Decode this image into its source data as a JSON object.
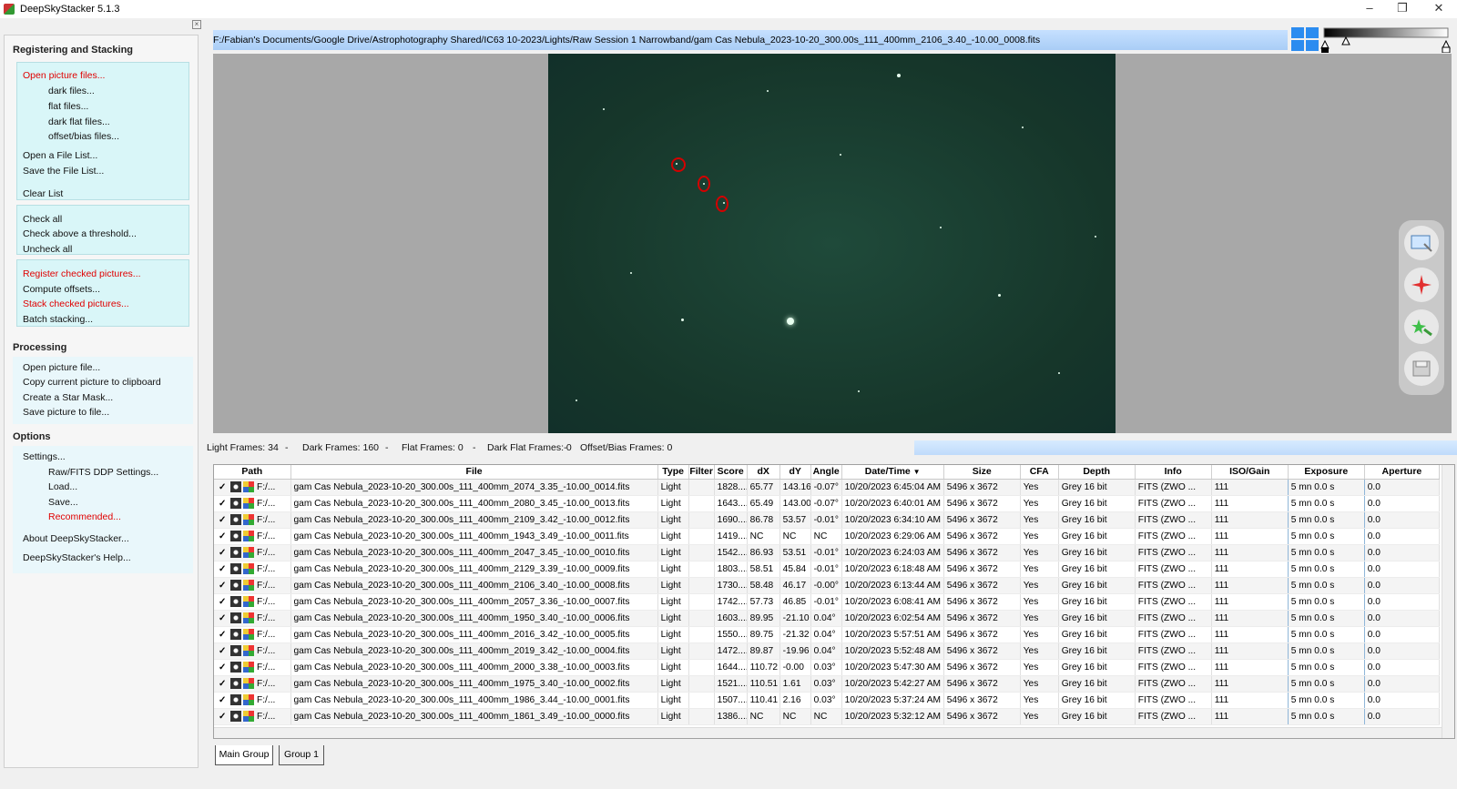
{
  "window": {
    "title": "DeepSkyStacker 5.1.3",
    "controls": [
      "–",
      "❐",
      "✕"
    ]
  },
  "sidebar": {
    "section_registering": "Registering and Stacking",
    "open_picture_files": "Open picture files...",
    "dark_files": "dark files...",
    "flat_files": "flat files...",
    "dark_flat_files": "dark flat files...",
    "offset_bias_files": "offset/bias files...",
    "open_file_list": "Open a File List...",
    "save_file_list": "Save the File List...",
    "clear_list": "Clear List",
    "check_all": "Check all",
    "check_above": "Check above a threshold...",
    "uncheck_all": "Uncheck all",
    "register_checked": "Register checked pictures...",
    "compute_offsets": "Compute offsets...",
    "stack_checked": "Stack checked pictures...",
    "batch_stacking": "Batch stacking...",
    "section_processing": "Processing",
    "open_picture_file": "Open picture file...",
    "copy_clipboard": "Copy current picture to clipboard",
    "create_star_mask": "Create a Star Mask...",
    "save_picture": "Save picture to file...",
    "section_options": "Options",
    "settings": "Settings...",
    "raw_fits": "Raw/FITS DDP Settings...",
    "load": "Load...",
    "save": "Save...",
    "recommended": "Recommended...",
    "about": "About DeepSkyStacker...",
    "help": "DeepSkyStacker's Help..."
  },
  "viewer": {
    "path": "F:/Fabian's Documents/Google Drive/Astrophotography Shared/IC63 10-2023/Lights/Raw Session 1 Narrowband/gam Cas Nebula_2023-10-20_300.00s_111_400mm_2106_3.40_-10.00_0008.fits"
  },
  "counts": {
    "light": "Light Frames: 34",
    "dark": "Dark Frames: 160",
    "flat": "Flat Frames: 0",
    "dark_flat": "Dark Flat Frames: 0",
    "offset": "Offset/Bias Frames: 0",
    "sep": "-"
  },
  "table": {
    "columns": [
      "Path",
      "File",
      "Type",
      "Filter",
      "Score",
      "dX",
      "dY",
      "Angle",
      "Date/Time",
      "Size",
      "CFA",
      "Depth",
      "Info",
      "ISO/Gain",
      "Exposure",
      "Aperture"
    ],
    "rows": [
      [
        "F:/...",
        "gam Cas Nebula_2023-10-20_300.00s_111_400mm_2074_3.35_-10.00_0014.fits",
        "Light",
        "",
        "1828....",
        "65.77",
        "143.16",
        "-0.07°",
        "10/20/2023 6:45:04 AM",
        "5496 x 3672",
        "Yes",
        "Grey 16 bit",
        "FITS (ZWO ...",
        "111",
        "5 mn 0.0 s",
        "0.0"
      ],
      [
        "F:/...",
        "gam Cas Nebula_2023-10-20_300.00s_111_400mm_2080_3.45_-10.00_0013.fits",
        "Light",
        "",
        "1643....",
        "65.49",
        "143.00",
        "-0.07°",
        "10/20/2023 6:40:01 AM",
        "5496 x 3672",
        "Yes",
        "Grey 16 bit",
        "FITS (ZWO ...",
        "111",
        "5 mn 0.0 s",
        "0.0"
      ],
      [
        "F:/...",
        "gam Cas Nebula_2023-10-20_300.00s_111_400mm_2109_3.42_-10.00_0012.fits",
        "Light",
        "",
        "1690....",
        "86.78",
        "53.57",
        "-0.01°",
        "10/20/2023 6:34:10 AM",
        "5496 x 3672",
        "Yes",
        "Grey 16 bit",
        "FITS (ZWO ...",
        "111",
        "5 mn 0.0 s",
        "0.0"
      ],
      [
        "F:/...",
        "gam Cas Nebula_2023-10-20_300.00s_111_400mm_1943_3.49_-10.00_0011.fits",
        "Light",
        "",
        "1419....",
        "NC",
        "NC",
        "NC",
        "10/20/2023 6:29:06 AM",
        "5496 x 3672",
        "Yes",
        "Grey 16 bit",
        "FITS (ZWO ...",
        "111",
        "5 mn 0.0 s",
        "0.0"
      ],
      [
        "F:/...",
        "gam Cas Nebula_2023-10-20_300.00s_111_400mm_2047_3.45_-10.00_0010.fits",
        "Light",
        "",
        "1542....",
        "86.93",
        "53.51",
        "-0.01°",
        "10/20/2023 6:24:03 AM",
        "5496 x 3672",
        "Yes",
        "Grey 16 bit",
        "FITS (ZWO ...",
        "111",
        "5 mn 0.0 s",
        "0.0"
      ],
      [
        "F:/...",
        "gam Cas Nebula_2023-10-20_300.00s_111_400mm_2129_3.39_-10.00_0009.fits",
        "Light",
        "",
        "1803....",
        "58.51",
        "45.84",
        "-0.01°",
        "10/20/2023 6:18:48 AM",
        "5496 x 3672",
        "Yes",
        "Grey 16 bit",
        "FITS (ZWO ...",
        "111",
        "5 mn 0.0 s",
        "0.0"
      ],
      [
        "F:/...",
        "gam Cas Nebula_2023-10-20_300.00s_111_400mm_2106_3.40_-10.00_0008.fits",
        "Light",
        "",
        "1730....",
        "58.48",
        "46.17",
        "-0.00°",
        "10/20/2023 6:13:44 AM",
        "5496 x 3672",
        "Yes",
        "Grey 16 bit",
        "FITS (ZWO ...",
        "111",
        "5 mn 0.0 s",
        "0.0"
      ],
      [
        "F:/...",
        "gam Cas Nebula_2023-10-20_300.00s_111_400mm_2057_3.36_-10.00_0007.fits",
        "Light",
        "",
        "1742....",
        "57.73",
        "46.85",
        "-0.01°",
        "10/20/2023 6:08:41 AM",
        "5496 x 3672",
        "Yes",
        "Grey 16 bit",
        "FITS (ZWO ...",
        "111",
        "5 mn 0.0 s",
        "0.0"
      ],
      [
        "F:/...",
        "gam Cas Nebula_2023-10-20_300.00s_111_400mm_1950_3.40_-10.00_0006.fits",
        "Light",
        "",
        "1603....",
        "89.95",
        "-21.10",
        "0.04°",
        "10/20/2023 6:02:54 AM",
        "5496 x 3672",
        "Yes",
        "Grey 16 bit",
        "FITS (ZWO ...",
        "111",
        "5 mn 0.0 s",
        "0.0"
      ],
      [
        "F:/...",
        "gam Cas Nebula_2023-10-20_300.00s_111_400mm_2016_3.42_-10.00_0005.fits",
        "Light",
        "",
        "1550....",
        "89.75",
        "-21.32",
        "0.04°",
        "10/20/2023 5:57:51 AM",
        "5496 x 3672",
        "Yes",
        "Grey 16 bit",
        "FITS (ZWO ...",
        "111",
        "5 mn 0.0 s",
        "0.0"
      ],
      [
        "F:/...",
        "gam Cas Nebula_2023-10-20_300.00s_111_400mm_2019_3.42_-10.00_0004.fits",
        "Light",
        "",
        "1472....",
        "89.87",
        "-19.96",
        "0.04°",
        "10/20/2023 5:52:48 AM",
        "5496 x 3672",
        "Yes",
        "Grey 16 bit",
        "FITS (ZWO ...",
        "111",
        "5 mn 0.0 s",
        "0.0"
      ],
      [
        "F:/...",
        "gam Cas Nebula_2023-10-20_300.00s_111_400mm_2000_3.38_-10.00_0003.fits",
        "Light",
        "",
        "1644....",
        "110.72",
        "-0.00",
        "0.03°",
        "10/20/2023 5:47:30 AM",
        "5496 x 3672",
        "Yes",
        "Grey 16 bit",
        "FITS (ZWO ...",
        "111",
        "5 mn 0.0 s",
        "0.0"
      ],
      [
        "F:/...",
        "gam Cas Nebula_2023-10-20_300.00s_111_400mm_1975_3.40_-10.00_0002.fits",
        "Light",
        "",
        "1521....",
        "110.51",
        "1.61",
        "0.03°",
        "10/20/2023 5:42:27 AM",
        "5496 x 3672",
        "Yes",
        "Grey 16 bit",
        "FITS (ZWO ...",
        "111",
        "5 mn 0.0 s",
        "0.0"
      ],
      [
        "F:/...",
        "gam Cas Nebula_2023-10-20_300.00s_111_400mm_1986_3.44_-10.00_0001.fits",
        "Light",
        "",
        "1507....",
        "110.41",
        "2.16",
        "0.03°",
        "10/20/2023 5:37:24 AM",
        "5496 x 3672",
        "Yes",
        "Grey 16 bit",
        "FITS (ZWO ...",
        "111",
        "5 mn 0.0 s",
        "0.0"
      ],
      [
        "F:/...",
        "gam Cas Nebula_2023-10-20_300.00s_111_400mm_1861_3.49_-10.00_0000.fits",
        "Light",
        "",
        "1386....",
        "NC",
        "NC",
        "NC",
        "10/20/2023 5:32:12 AM",
        "5496 x 3672",
        "Yes",
        "Grey 16 bit",
        "FITS (ZWO ...",
        "111",
        "5 mn 0.0 s",
        "0.0"
      ]
    ]
  },
  "tabs": [
    "Main Group",
    "Group 1"
  ],
  "colors": {
    "accent_red": "#e00000",
    "group_bg": "#d9f6f8",
    "pathbar": "#b8d7fa"
  }
}
